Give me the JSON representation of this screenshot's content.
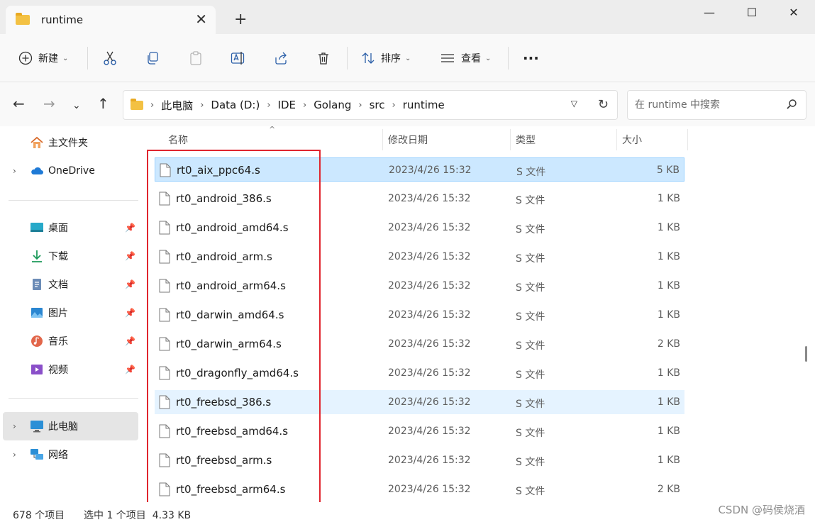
{
  "window": {
    "tab_title": "runtime",
    "new_tab": "+",
    "minimize": "—",
    "maximize": "☐",
    "close": "✕"
  },
  "toolbar": {
    "new_label": "新建",
    "sort_label": "排序",
    "view_label": "查看",
    "more_label": "···"
  },
  "address": {
    "crumbs": [
      "此电脑",
      "Data (D:)",
      "IDE",
      "Golang",
      "src",
      "runtime"
    ],
    "search_placeholder": "在 runtime 中搜索"
  },
  "sidebar": {
    "items": [
      {
        "label": "主文件夹"
      },
      {
        "label": "OneDrive"
      },
      {
        "label": "桌面"
      },
      {
        "label": "下载"
      },
      {
        "label": "文档"
      },
      {
        "label": "图片"
      },
      {
        "label": "音乐"
      },
      {
        "label": "视频"
      },
      {
        "label": "此电脑"
      },
      {
        "label": "网络"
      }
    ]
  },
  "columns": {
    "name": "名称",
    "date": "修改日期",
    "type": "类型",
    "size": "大小"
  },
  "files": [
    {
      "name": "rt0_aix_ppc64.s",
      "date": "2023/4/26 15:32",
      "type": "S 文件",
      "size": "5 KB"
    },
    {
      "name": "rt0_android_386.s",
      "date": "2023/4/26 15:32",
      "type": "S 文件",
      "size": "1 KB"
    },
    {
      "name": "rt0_android_amd64.s",
      "date": "2023/4/26 15:32",
      "type": "S 文件",
      "size": "1 KB"
    },
    {
      "name": "rt0_android_arm.s",
      "date": "2023/4/26 15:32",
      "type": "S 文件",
      "size": "1 KB"
    },
    {
      "name": "rt0_android_arm64.s",
      "date": "2023/4/26 15:32",
      "type": "S 文件",
      "size": "1 KB"
    },
    {
      "name": "rt0_darwin_amd64.s",
      "date": "2023/4/26 15:32",
      "type": "S 文件",
      "size": "1 KB"
    },
    {
      "name": "rt0_darwin_arm64.s",
      "date": "2023/4/26 15:32",
      "type": "S 文件",
      "size": "2 KB"
    },
    {
      "name": "rt0_dragonfly_amd64.s",
      "date": "2023/4/26 15:32",
      "type": "S 文件",
      "size": "1 KB"
    },
    {
      "name": "rt0_freebsd_386.s",
      "date": "2023/4/26 15:32",
      "type": "S 文件",
      "size": "1 KB"
    },
    {
      "name": "rt0_freebsd_amd64.s",
      "date": "2023/4/26 15:32",
      "type": "S 文件",
      "size": "1 KB"
    },
    {
      "name": "rt0_freebsd_arm.s",
      "date": "2023/4/26 15:32",
      "type": "S 文件",
      "size": "1 KB"
    },
    {
      "name": "rt0_freebsd_arm64.s",
      "date": "2023/4/26 15:32",
      "type": "S 文件",
      "size": "2 KB"
    }
  ],
  "status": {
    "item_count": "678 个项目",
    "selection": "选中 1 个项目  4.33 KB"
  },
  "watermark": "CSDN @码侯烧酒",
  "colors": {
    "selected_row": "#cce8ff",
    "hover_row": "#e5f3ff",
    "annotation_box": "#e0252e",
    "folder": "#f3c143"
  }
}
